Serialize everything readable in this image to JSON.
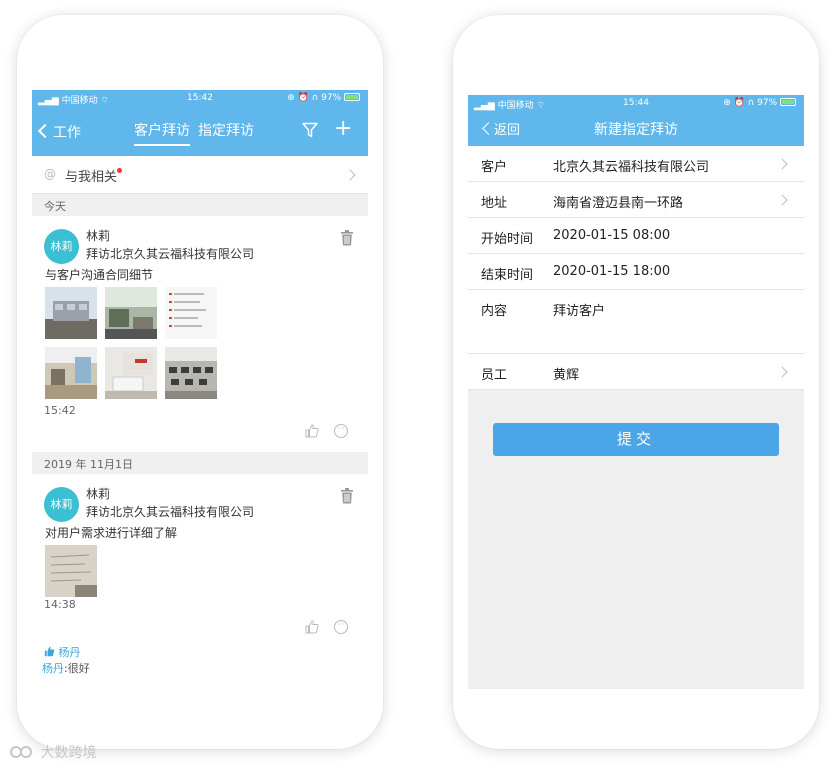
{
  "left": {
    "status": {
      "carrier": "中国移动",
      "time": "15:42",
      "battery": "97%"
    },
    "nav": {
      "back_label": "工作",
      "tabs": [
        "客户拜访",
        "指定拜访"
      ],
      "active_tab": 0
    },
    "mention": {
      "label": "与我相关"
    },
    "sections": [
      {
        "date": "今天",
        "post": {
          "avatar_text": "林莉",
          "name": "林莉",
          "subtitle": "拜访北京久其云福科技有限公司",
          "text": "与客户沟通合同细节",
          "photo_count": 6,
          "time": "15:42"
        }
      },
      {
        "date": "2019 年 11月1日",
        "post": {
          "avatar_text": "林莉",
          "name": "林莉",
          "subtitle": "拜访北京久其云福科技有限公司",
          "text": "对用户需求进行详细了解",
          "photo_count": 1,
          "time": "14:38",
          "liker": "杨丹",
          "comment_author": "杨丹",
          "comment_text": ":很好"
        }
      }
    ]
  },
  "right": {
    "status": {
      "carrier": "中国移动",
      "time": "15:44",
      "battery": "97%"
    },
    "nav": {
      "back_label": "返回",
      "title": "新建指定拜访"
    },
    "form": [
      {
        "label": "客户",
        "value": "北京久其云福科技有限公司",
        "arrow": true
      },
      {
        "label": "地址",
        "value": "海南省澄迈县南一环路",
        "arrow": true
      },
      {
        "label": "开始时间",
        "value": "2020-01-15 08:00",
        "arrow": false
      },
      {
        "label": "结束时间",
        "value": "2020-01-15 18:00",
        "arrow": false
      },
      {
        "label": "内容",
        "value": "拜访客户",
        "arrow": false
      },
      {
        "label": "员工",
        "value": "黄辉",
        "arrow": true
      }
    ],
    "submit_label": "提交"
  },
  "watermark": "大数跨境",
  "colors": {
    "nav_blue": "#5fb7ec",
    "button_blue": "#4aa6e6",
    "avatar_teal": "#3bbfd2",
    "accent_link": "#3aa7dc"
  }
}
